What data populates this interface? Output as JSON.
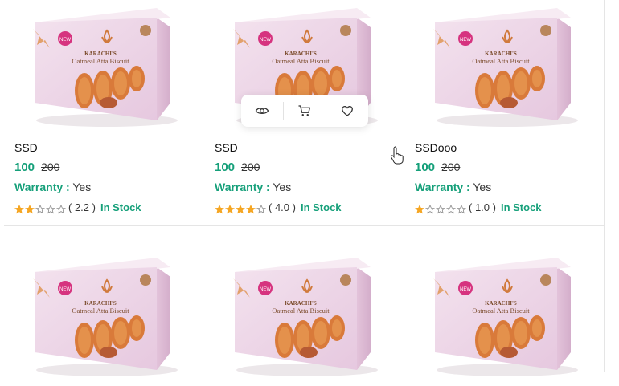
{
  "colors": {
    "accent": "#16a07a",
    "star": "#f5a623",
    "border": "#e5e5e5"
  },
  "box_text": {
    "brand": "KARACHI'S",
    "title": "Oatmeal Atta Biscuit"
  },
  "products": [
    {
      "name": "SSD",
      "price": "100",
      "old_price": "200",
      "warranty_label": "Warranty :",
      "warranty_value": "Yes",
      "rating": 2.2,
      "rating_text": "( 2.2 )",
      "stock": "In Stock"
    },
    {
      "name": "SSD",
      "price": "100",
      "old_price": "200",
      "warranty_label": "Warranty :",
      "warranty_value": "Yes",
      "rating": 4.0,
      "rating_text": "( 4.0 )",
      "stock": "In Stock"
    },
    {
      "name": "SSDooo",
      "price": "100",
      "old_price": "200",
      "warranty_label": "Warranty :",
      "warranty_value": "Yes",
      "rating": 1.0,
      "rating_text": "( 1.0 )",
      "stock": "In Stock"
    }
  ],
  "quick_actions": [
    {
      "icon": "eye-icon"
    },
    {
      "icon": "cart-icon"
    },
    {
      "icon": "heart-icon"
    }
  ]
}
